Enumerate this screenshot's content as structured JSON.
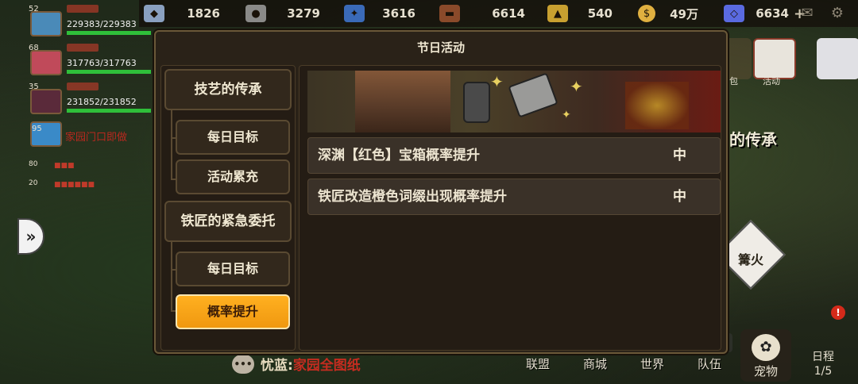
{
  "resources": [
    {
      "name": "stone",
      "icon": "crystal-icon",
      "value": "1826",
      "color": "#8aa0c0"
    },
    {
      "name": "iron",
      "icon": "ore-icon",
      "value": "3279",
      "color": "#8a8a88"
    },
    {
      "name": "crystal",
      "icon": "blue-crystal-icon",
      "value": "3616",
      "color": "#3a6ab8"
    },
    {
      "name": "wood",
      "icon": "wood-icon",
      "value": "6614",
      "color": "#8a4a2a"
    },
    {
      "name": "gold-ore",
      "icon": "gold-ore-icon",
      "value": "540",
      "color": "#c8a030"
    },
    {
      "name": "coin",
      "icon": "coin-icon",
      "value": "49万",
      "color": "#e0b040"
    },
    {
      "name": "diamond",
      "icon": "diamond-icon",
      "value": "6634",
      "color": "#5a6ae0"
    }
  ],
  "party": [
    {
      "level": "52",
      "hp": "229383/229383",
      "hp_pct": 100,
      "color": "#4a8ab8"
    },
    {
      "level": "68",
      "hp": "317763/317763",
      "hp_pct": 100,
      "color": "#c04a5a"
    },
    {
      "level": "35",
      "hp": "231852/231852",
      "hp_pct": 100,
      "color": "#5a2a3a"
    },
    {
      "level": "95",
      "hp": "",
      "hp_pct": 0,
      "color": "#3a8ac8"
    }
  ],
  "party_small": [
    {
      "level": "80"
    },
    {
      "level": "20"
    }
  ],
  "home_notice": "家园门口即做",
  "modal": {
    "title": "节日活动",
    "categories": [
      {
        "label": "技艺的传承",
        "subs": [
          {
            "label": "每日目标",
            "active": false
          },
          {
            "label": "活动累充",
            "active": false
          }
        ]
      },
      {
        "label": "铁匠的紧急委托",
        "subs": [
          {
            "label": "每日目标",
            "active": false
          },
          {
            "label": "概率提升",
            "active": true
          }
        ]
      }
    ],
    "rows": [
      {
        "label": "深渊【红色】宝箱概率提升",
        "value": "中"
      },
      {
        "label": "铁匠改造橙色词缀出现概率提升",
        "value": "中"
      }
    ]
  },
  "side": {
    "text": "的传承",
    "bonfire": "篝火",
    "bag": "包",
    "activity": "活动"
  },
  "chat": {
    "icon": "chat-bubble-icon",
    "who": "忧蓝:",
    "message": "家园全图纸"
  },
  "nav": [
    {
      "label": "联盟"
    },
    {
      "label": "商城"
    },
    {
      "label": "世界"
    },
    {
      "label": "队伍"
    }
  ],
  "pet": {
    "label": "宠物"
  },
  "schedule": {
    "label": "日程",
    "progress": "1/5",
    "badge": "!"
  }
}
